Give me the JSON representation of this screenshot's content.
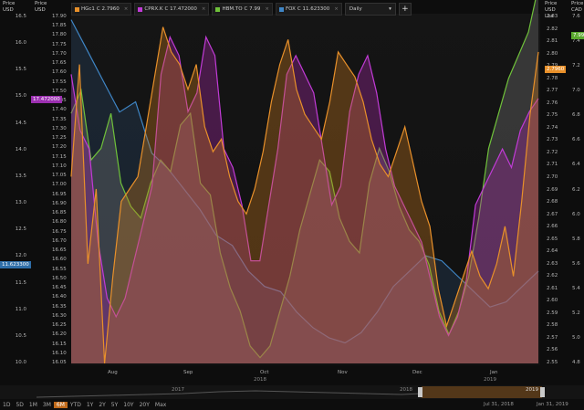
{
  "legend": [
    {
      "name": "HGc1",
      "text": "C 2.7960",
      "color": "#e8902a"
    },
    {
      "name": "CPRX.K",
      "text": "C 17.472000",
      "color": "#c13bd6"
    },
    {
      "name": "HBM.TO",
      "text": "C 7.99",
      "color": "#6fc13a"
    },
    {
      "name": "FOX",
      "text": "C 11.623300",
      "color": "#3f86c6"
    }
  ],
  "interval_select": "Daily",
  "add_button": "+",
  "axes": {
    "left1": {
      "title": "Price\nUSD",
      "ticks": [
        "16.5",
        "16.0",
        "15.5",
        "15.0",
        "14.5",
        "14.0",
        "13.5",
        "13.0",
        "12.5",
        "12.0",
        "11.5",
        "11.0",
        "10.5",
        "10.0"
      ]
    },
    "left2": {
      "title": "Price\nUSD",
      "ticks": [
        "17.90",
        "17.85",
        "17.80",
        "17.75",
        "17.70",
        "17.65",
        "17.60",
        "17.55",
        "17.50",
        "17.45",
        "17.40",
        "17.35",
        "17.30",
        "17.25",
        "17.20",
        "17.15",
        "17.10",
        "17.05",
        "17.00",
        "16.95",
        "16.90",
        "16.85",
        "16.80",
        "16.75",
        "16.70",
        "16.65",
        "16.60",
        "16.55",
        "16.50",
        "16.45",
        "16.40",
        "16.35",
        "16.30",
        "16.25",
        "16.20",
        "16.15",
        "16.10",
        "16.05"
      ]
    },
    "right1": {
      "title": "Price\nUSD\nLbs",
      "ticks": [
        "2.83",
        "2.82",
        "2.81",
        "2.80",
        "2.79",
        "2.78",
        "2.77",
        "2.76",
        "2.75",
        "2.74",
        "2.73",
        "2.72",
        "2.71",
        "2.70",
        "2.69",
        "2.68",
        "2.67",
        "2.66",
        "2.65",
        "2.64",
        "2.63",
        "2.62",
        "2.61",
        "2.60",
        "2.59",
        "2.58",
        "2.57",
        "2.56",
        "2.55"
      ]
    },
    "right2": {
      "title": "Price\nCAD",
      "ticks": [
        "7.6",
        "7.4",
        "7.2",
        "7.0",
        "6.8",
        "6.6",
        "6.4",
        "6.2",
        "6.0",
        "5.8",
        "5.6",
        "5.4",
        "5.2",
        "5.0",
        "4.8"
      ]
    }
  },
  "badges": {
    "cprx": "17.472000",
    "fox": "11.623300",
    "hg": "2.7960",
    "hbm": "7.99"
  },
  "x_months": [
    "Aug",
    "Sep",
    "Oct",
    "Nov",
    "Dec",
    "Jan"
  ],
  "x_years": [
    "2018",
    "2019"
  ],
  "navigator_years": [
    "2017",
    "2018",
    "2019"
  ],
  "periods": [
    "1D",
    "5D",
    "1M",
    "3M",
    "6M",
    "YTD",
    "1Y",
    "2Y",
    "5Y",
    "10Y",
    "20Y",
    "Max"
  ],
  "active_period": "6M",
  "range_start": "Jul 31, 2018",
  "range_end": "Jan 31, 2019",
  "chart_data": {
    "type": "area",
    "series": [
      {
        "name": "HGc1",
        "color": "#e8902a",
        "values": [
          2.7,
          2.79,
          2.63,
          2.69,
          2.55,
          2.62,
          2.68,
          2.69,
          2.7,
          2.74,
          2.78,
          2.82,
          2.8,
          2.79,
          2.77,
          2.79,
          2.74,
          2.72,
          2.73,
          2.7,
          2.68,
          2.67,
          2.69,
          2.72,
          2.76,
          2.79,
          2.81,
          2.77,
          2.75,
          2.74,
          2.73,
          2.76,
          2.8,
          2.79,
          2.78,
          2.76,
          2.73,
          2.71,
          2.7,
          2.72,
          2.74,
          2.71,
          2.68,
          2.66,
          2.61,
          2.58,
          2.6,
          2.62,
          2.64,
          2.62,
          2.61,
          2.63,
          2.66,
          2.62,
          2.68,
          2.75,
          2.8
        ]
      },
      {
        "name": "CPRX.K",
        "color": "#c13bd6",
        "values": [
          17.6,
          17.3,
          17.2,
          16.7,
          16.4,
          16.3,
          16.4,
          16.6,
          16.8,
          17.0,
          17.6,
          17.8,
          17.7,
          17.4,
          17.5,
          17.8,
          17.7,
          17.2,
          17.1,
          16.9,
          16.6,
          16.6,
          16.9,
          17.2,
          17.6,
          17.7,
          17.6,
          17.5,
          17.2,
          16.9,
          17.0,
          17.4,
          17.6,
          17.7,
          17.5,
          17.2,
          17.0,
          16.9,
          16.8,
          16.7,
          16.5,
          16.3,
          16.2,
          16.3,
          16.5,
          16.9,
          17.0,
          17.1,
          17.2,
          17.1,
          17.3,
          17.4,
          17.47
        ]
      },
      {
        "name": "HBM.TO",
        "color": "#6fc13a",
        "values": [
          6.9,
          7.1,
          6.5,
          6.6,
          6.9,
          6.3,
          6.1,
          6.0,
          6.3,
          6.5,
          6.4,
          6.8,
          6.9,
          6.3,
          6.2,
          5.7,
          5.4,
          5.2,
          4.9,
          4.8,
          4.9,
          5.2,
          5.5,
          5.9,
          6.2,
          6.5,
          6.4,
          6.0,
          5.8,
          5.7,
          6.3,
          6.6,
          6.4,
          6.1,
          5.9,
          5.8,
          5.6,
          5.2,
          5.0,
          5.2,
          5.5,
          6.0,
          6.6,
          6.9,
          7.2,
          7.4,
          7.6,
          7.99
        ]
      },
      {
        "name": "FOX",
        "color": "#3f86c6",
        "values": [
          16.5,
          15.9,
          15.3,
          14.7,
          14.9,
          13.9,
          13.6,
          13.2,
          12.8,
          12.3,
          12.1,
          11.6,
          11.3,
          11.2,
          10.8,
          10.5,
          10.3,
          10.2,
          10.4,
          10.8,
          11.3,
          11.6,
          11.9,
          11.8,
          11.5,
          11.2,
          10.9,
          11.0,
          11.3,
          11.6
        ]
      }
    ],
    "ylim_cprx": [
      16.05,
      17.92
    ],
    "ylim_fox": [
      9.8,
      16.6
    ],
    "ylim_hg": [
      2.55,
      2.83
    ],
    "ylim_hbm": [
      4.75,
      7.75
    ]
  }
}
